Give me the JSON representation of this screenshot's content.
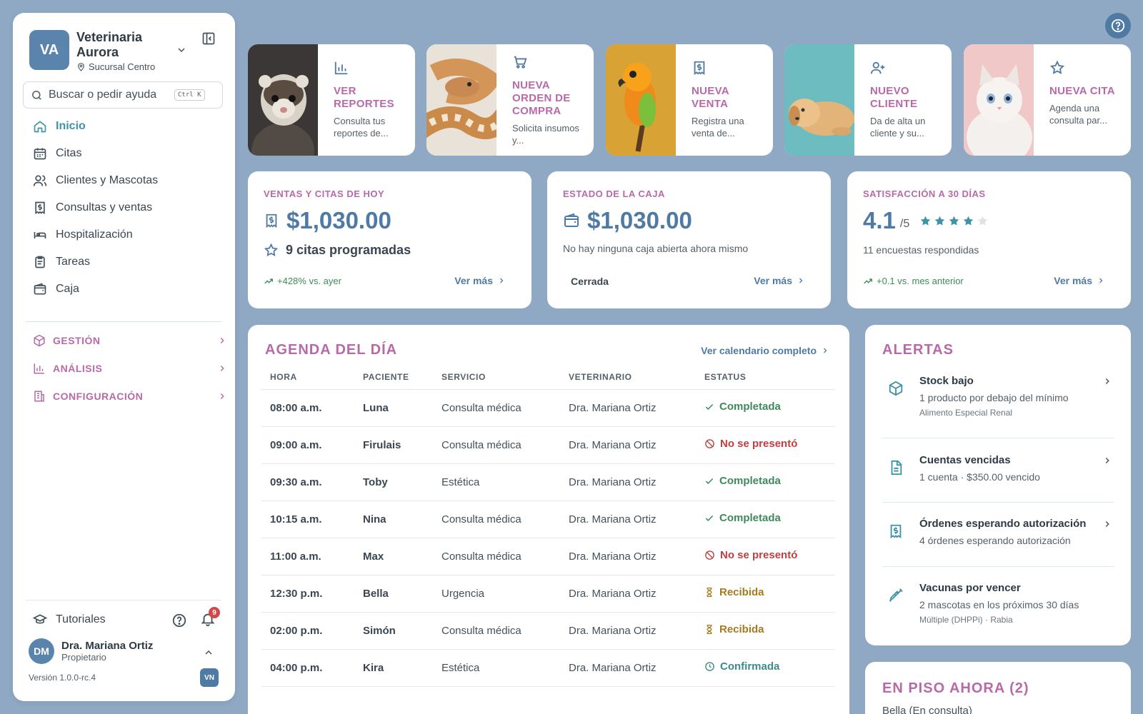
{
  "brand": {
    "initials": "VA",
    "name": "Veterinaria Aurora",
    "branch": "Sucursal Centro"
  },
  "search": {
    "placeholder": "Buscar o pedir ayuda",
    "shortcut": "Ctrl K"
  },
  "nav": [
    {
      "label": "Inicio",
      "icon": "home-icon",
      "active": true
    },
    {
      "label": "Citas",
      "icon": "calendar-icon"
    },
    {
      "label": "Clientes y Mascotas",
      "icon": "users-icon"
    },
    {
      "label": "Consultas y ventas",
      "icon": "receipt-icon"
    },
    {
      "label": "Hospitalización",
      "icon": "bed-icon"
    },
    {
      "label": "Tareas",
      "icon": "clipboard-icon"
    },
    {
      "label": "Caja",
      "icon": "wallet-icon"
    }
  ],
  "groups": [
    {
      "label": "GESTIÓN",
      "icon": "box-icon"
    },
    {
      "label": "ANÁLISIS",
      "icon": "bar-chart-icon"
    },
    {
      "label": "CONFIGURACIÓN",
      "icon": "building-icon"
    }
  ],
  "footer": {
    "tutorials": "Tutoriales",
    "notifications": "9",
    "user_initials": "DM",
    "user_name": "Dra. Mariana Ortiz",
    "user_role": "Propietario",
    "version": "Versión 1.0.0-rc.4",
    "version_badge": "VN"
  },
  "quick_actions": [
    {
      "title": "VER REPORTES",
      "desc": "Consulta tus reportes de...",
      "icon": "bar-chart-icon",
      "image": "ferret"
    },
    {
      "title": "NUEVA ORDEN DE COMPRA",
      "desc": "Solicita insumos y...",
      "icon": "cart-icon",
      "image": "snake"
    },
    {
      "title": "NUEVA VENTA",
      "desc": "Registra una venta de...",
      "icon": "receipt-icon",
      "image": "parrot"
    },
    {
      "title": "NUEVO CLIENTE",
      "desc": "Da de alta un cliente y su...",
      "icon": "user-plus-icon",
      "image": "puppy"
    },
    {
      "title": "NUEVA CITA",
      "desc": "Agenda una consulta par...",
      "icon": "star-icon",
      "image": "kitten"
    }
  ],
  "stats": {
    "sales": {
      "label": "VENTAS Y CITAS DE HOY",
      "amount": "$1,030.00",
      "appointments": "9 citas programadas",
      "trend": "+428% vs. ayer",
      "more": "Ver más"
    },
    "cash": {
      "label": "ESTADO DE LA CAJA",
      "amount": "$1,030.00",
      "note": "No hay ninguna caja abierta ahora mismo",
      "status": "Cerrada",
      "more": "Ver más"
    },
    "satisfaction": {
      "label": "SATISFACCIÓN A 30 DÍAS",
      "score": "4.1",
      "scale": "/5",
      "rating": 4,
      "max_rating": 5,
      "responses": "11 encuestas respondidas",
      "trend": "+0.1 vs. mes anterior",
      "more": "Ver más"
    }
  },
  "agenda": {
    "title": "AGENDA DEL DÍA",
    "link": "Ver calendario completo",
    "columns": [
      "HORA",
      "PACIENTE",
      "SERVICIO",
      "VETERINARIO",
      "ESTATUS"
    ],
    "rows": [
      {
        "time": "08:00 a.m.",
        "patient": "Luna",
        "service": "Consulta médica",
        "vet": "Dra. Mariana Ortiz",
        "status": "Completada",
        "kind": "completada"
      },
      {
        "time": "09:00 a.m.",
        "patient": "Firulais",
        "service": "Consulta médica",
        "vet": "Dra. Mariana Ortiz",
        "status": "No se presentó",
        "kind": "nose"
      },
      {
        "time": "09:30 a.m.",
        "patient": "Toby",
        "service": "Estética",
        "vet": "Dra. Mariana Ortiz",
        "status": "Completada",
        "kind": "completada"
      },
      {
        "time": "10:15 a.m.",
        "patient": "Nina",
        "service": "Consulta médica",
        "vet": "Dra. Mariana Ortiz",
        "status": "Completada",
        "kind": "completada"
      },
      {
        "time": "11:00 a.m.",
        "patient": "Max",
        "service": "Consulta médica",
        "vet": "Dra. Mariana Ortiz",
        "status": "No se presentó",
        "kind": "nose"
      },
      {
        "time": "12:30 p.m.",
        "patient": "Bella",
        "service": "Urgencia",
        "vet": "Dra. Mariana Ortiz",
        "status": "Recibida",
        "kind": "recibida"
      },
      {
        "time": "02:00 p.m.",
        "patient": "Simón",
        "service": "Consulta médica",
        "vet": "Dra. Mariana Ortiz",
        "status": "Recibida",
        "kind": "recibida"
      },
      {
        "time": "04:00 p.m.",
        "patient": "Kira",
        "service": "Estética",
        "vet": "Dra. Mariana Ortiz",
        "status": "Confirmada",
        "kind": "confirmada"
      }
    ]
  },
  "alerts": {
    "title": "ALERTAS",
    "items": [
      {
        "title": "Stock bajo",
        "desc": "1 producto por debajo del mínimo",
        "detail": "Alimento Especial Renal",
        "icon": "package-icon"
      },
      {
        "title": "Cuentas vencidas",
        "desc": "1 cuenta · $350.00 vencido",
        "detail": "",
        "icon": "document-icon"
      },
      {
        "title": "Órdenes esperando autorización",
        "desc": "4 órdenes esperando autorización",
        "detail": "",
        "icon": "receipt-icon"
      },
      {
        "title": "Vacunas por vencer",
        "desc": "2 mascotas en los próximos 30 días",
        "detail": "Múltiple (DHPPi) · Rabia",
        "icon": "syringe-icon"
      }
    ]
  },
  "on_floor": {
    "title": "EN PISO AHORA (2)",
    "first": "Bella (En consulta)"
  },
  "colors": {
    "accent": "#b86aa8",
    "primary": "#4f7aa4",
    "teal": "#3f93a6",
    "background": "#8fa8c3"
  }
}
